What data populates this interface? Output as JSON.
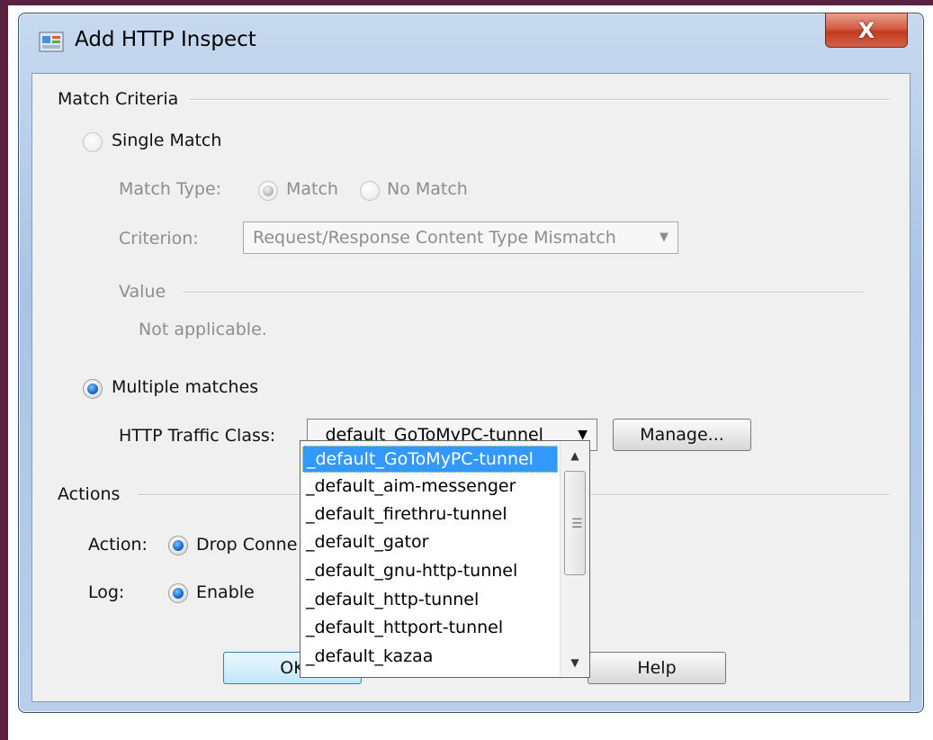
{
  "window": {
    "title": "Add HTTP Inspect",
    "close_label": "X"
  },
  "match_criteria": {
    "section_label": "Match Criteria",
    "single_match": {
      "label": "Single Match",
      "selected": false
    },
    "match_type": {
      "label": "Match Type:",
      "match_label": "Match",
      "no_match_label": "No Match",
      "selected": "Match"
    },
    "criterion": {
      "label": "Criterion:",
      "value": "Request/Response Content Type Mismatch"
    },
    "value": {
      "section_label": "Value",
      "text": "Not applicable."
    },
    "multiple_matches": {
      "label": "Multiple matches",
      "selected": true
    },
    "http_traffic_class": {
      "label": "HTTP Traffic Class:",
      "value": "_default_GoToMyPC-tunnel"
    },
    "manage_label": "Manage..."
  },
  "dropdown": {
    "items": [
      "_default_GoToMyPC-tunnel",
      "_default_aim-messenger",
      "_default_firethru-tunnel",
      "_default_gator",
      "_default_gnu-http-tunnel",
      "_default_http-tunnel",
      "_default_httport-tunnel",
      "_default_kazaa"
    ],
    "selected_index": 0,
    "grip": "☰"
  },
  "actions": {
    "section_label": "Actions",
    "action_label": "Action:",
    "action_value": "Drop Conne",
    "log_label": "Log:",
    "log_value": "Enable"
  },
  "buttons": {
    "ok_label": "OK",
    "help_label": "Help"
  },
  "colors": {
    "selection": "#3399ff",
    "frame": "#5a2140",
    "close": "#c13a20"
  }
}
